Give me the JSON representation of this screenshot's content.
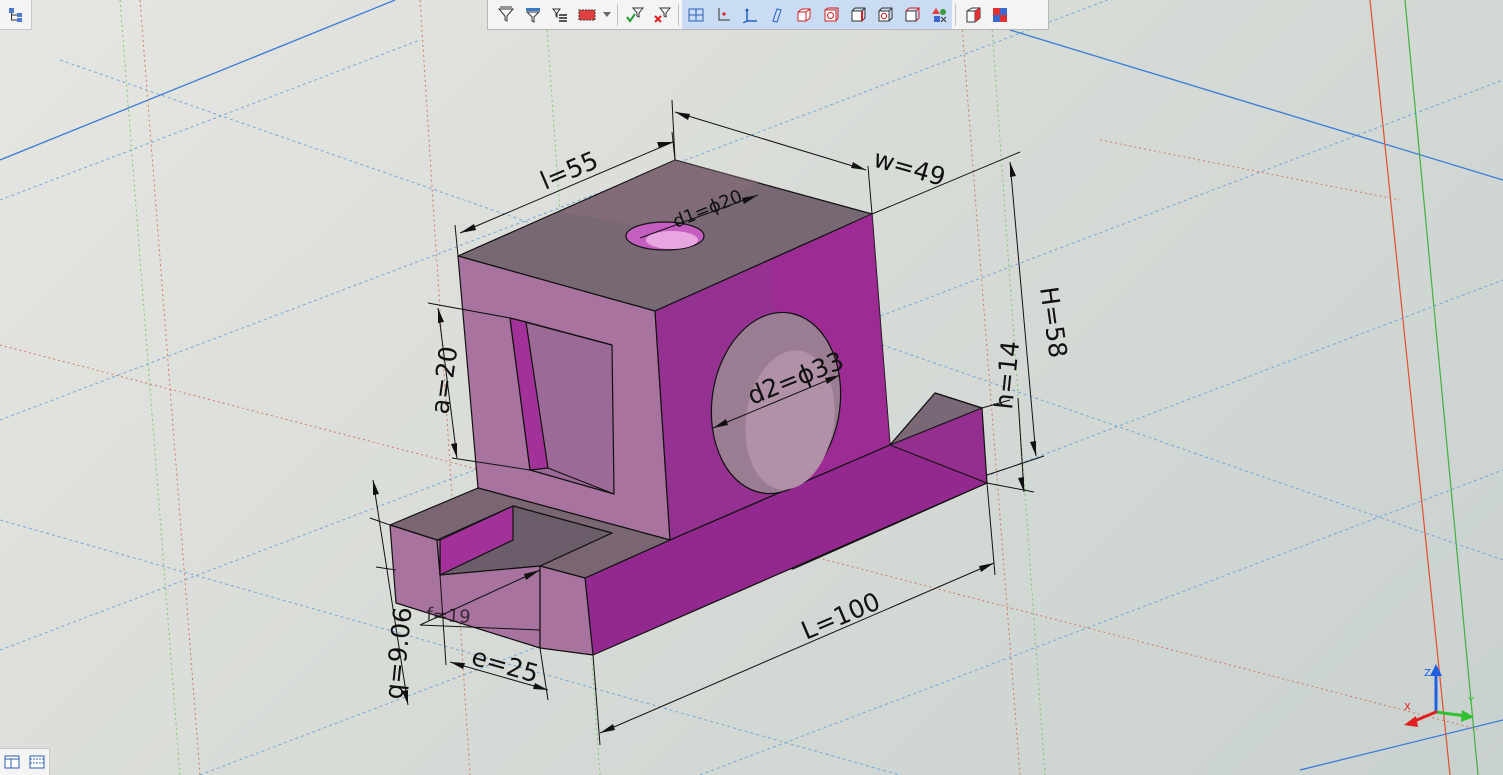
{
  "toolbar": {
    "groups": [
      [
        "filter-icon",
        "filter-select-icon",
        "select-list-icon",
        "select-color-icon",
        "dropdown-arrow-icon"
      ],
      [
        "filter-apply-icon",
        "filter-clear-icon"
      ],
      [
        "view-grid-icon",
        "axis-point-icon",
        "axis-system-icon",
        "workplane-icon",
        "solid-face-icon",
        "solid-hole-icon",
        "solid-edge-icon",
        "solid-shell-icon",
        "solid-body-icon",
        "geometry-shapes-icon"
      ],
      [
        "view-cube-icon",
        "display-mode-icon"
      ]
    ]
  },
  "colors": {
    "accent": "#a42aa4",
    "face_top": "#7a6572",
    "face_front": "#a8739f",
    "face_side": "#93308c"
  },
  "dimensions": {
    "l": "l=55",
    "w": "w=49",
    "d1": "d1=ϕ20",
    "H": "H=58",
    "h": "h=14",
    "a": "a=20",
    "d2": "d2=ϕ33",
    "L": "L=100",
    "e": "e=25",
    "q": "q=9.06",
    "f": "f=19"
  },
  "axes": {
    "x": "X",
    "y": "Y",
    "z": "Z"
  }
}
